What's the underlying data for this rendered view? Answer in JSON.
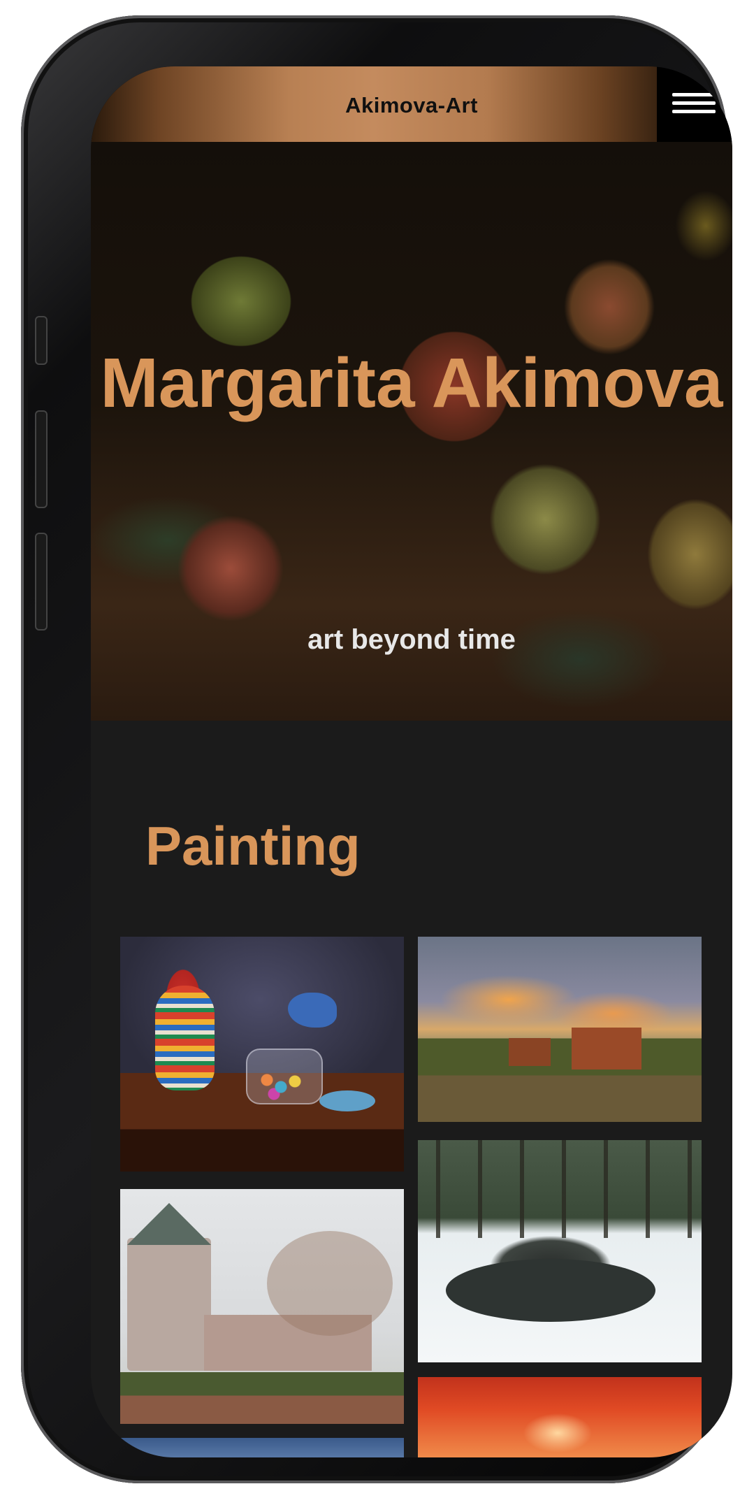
{
  "header": {
    "site_title": "Akimova-Art",
    "menu_icon": "hamburger-menu-icon"
  },
  "hero": {
    "name": "Margarita Akimova",
    "subtitle": "art beyond time"
  },
  "section": {
    "title": "Painting"
  },
  "gallery": [
    {
      "subject": "still-life-pitcher-bird-candies"
    },
    {
      "subject": "landscape-village-sunset"
    },
    {
      "subject": "fortress-tower-fog"
    },
    {
      "subject": "winter-stream-forest"
    },
    {
      "subject": "autumn-red-tree"
    },
    {
      "subject": "partial-painting-blue"
    }
  ],
  "colors": {
    "accent": "#d9965a",
    "header_gradient_center": "#c48b5e",
    "background": "#1b1b1b",
    "subtitle": "#e8e8e8"
  }
}
